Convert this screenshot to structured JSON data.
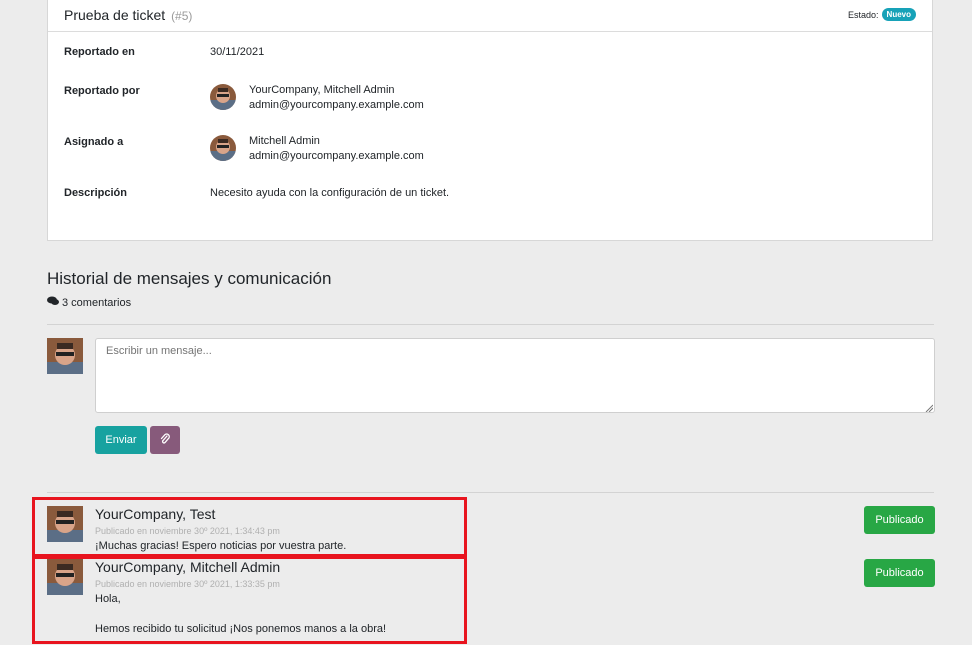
{
  "ticket": {
    "title": "Prueba de ticket",
    "number": "(#5)",
    "status_label": "Estado:",
    "status_badge": "Nuevo",
    "status_color": "#17a2b8",
    "fields": {
      "reported_on_label": "Reportado en",
      "reported_on_value": "30/11/2021",
      "reported_by_label": "Reportado por",
      "reported_by_name": "YourCompany, Mitchell Admin",
      "reported_by_email": "admin@yourcompany.example.com",
      "assigned_to_label": "Asignado a",
      "assigned_to_name": "Mitchell Admin",
      "assigned_to_email": "admin@yourcompany.example.com",
      "description_label": "Descripción",
      "description_value": "Necesito ayuda con la configuración de un ticket."
    }
  },
  "history": {
    "title": "Historial de mensajes y comunicación",
    "comments_count": "3 comentarios",
    "composer": {
      "placeholder": "Escribir un mensaje...",
      "send_label": "Enviar"
    },
    "messages": [
      {
        "author": "YourCompany, Test",
        "meta": "Publicado en noviembre 30º 2021, 1:34:43 pm",
        "body_lines": [
          "¡Muchas gracias! Espero noticias por vuestra parte."
        ],
        "publish_label": "Publicado"
      },
      {
        "author": "YourCompany, Mitchell Admin",
        "meta": "Publicado en noviembre 30º 2021, 1:33:35 pm",
        "body_lines": [
          "Hola,",
          "",
          "Hemos recibido tu solicitud ¡Nos ponemos manos a la obra!"
        ],
        "publish_label": "Publicado"
      }
    ]
  },
  "colors": {
    "accent_teal": "#17a2a0",
    "attach_purple": "#875a7b",
    "published_green": "#28a745",
    "highlight_red": "#e8141e"
  }
}
